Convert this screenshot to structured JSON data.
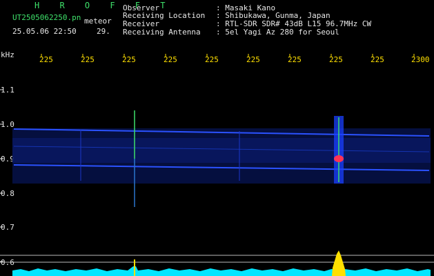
{
  "header": {
    "title": "H R O F F T",
    "filename": "UT2505062250.pn",
    "type": "meteor",
    "datetime": "25.05.06 22:50",
    "minute": "29."
  },
  "info": {
    "observer_label": "Observer",
    "observer_value": ": Masaki Kano",
    "location_label": "Receiving Location",
    "location_value": ": Shibukawa, Gunma, Japan",
    "receiver_label": "Receiver",
    "receiver_value": ": RTL-SDR SDR# 43dB L15 96.7MHz CW",
    "antenna_label": "Receiving Antenna",
    "antenna_value": ": 5el Yagi Az 280 for Seoul"
  },
  "axes": {
    "y_unit": "kHz",
    "x_ticks": [
      "225",
      "225",
      "225",
      "225",
      "225",
      "225",
      "225",
      "225",
      "225",
      "2300"
    ],
    "y_ticks": [
      "1.1",
      "1.0",
      "0.9",
      "0.8",
      "0.7",
      "0.6"
    ]
  },
  "colors": {
    "background": "#000000",
    "band": "#1f3fd8",
    "signal": "#3ee06a",
    "meteor_core": "#ff3355",
    "spectrum": "#00e5ff",
    "spectrum_peak": "#ffe000"
  }
}
